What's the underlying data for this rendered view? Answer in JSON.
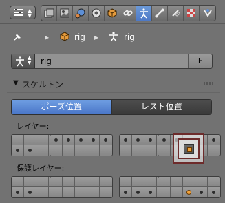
{
  "header": {
    "editor_type_icon": "properties-editor-icon",
    "context_tabs": [
      {
        "name": "render-layers-icon",
        "active": false
      },
      {
        "name": "scene-icon",
        "active": false
      },
      {
        "name": "world-icon",
        "active": false
      },
      {
        "name": "object-icon",
        "active": false
      },
      {
        "name": "cube-icon",
        "active": false
      },
      {
        "name": "constraints-link-icon",
        "active": false
      },
      {
        "name": "armature-data-icon",
        "active": true
      },
      {
        "name": "bone-icon",
        "active": false
      },
      {
        "name": "bone-constraints-icon",
        "active": false
      },
      {
        "name": "texture-icon",
        "active": false
      },
      {
        "name": "physics-icon",
        "active": false
      }
    ]
  },
  "breadcrumb": {
    "object_name": "rig",
    "data_name": "rig"
  },
  "datablock": {
    "name": "rig",
    "fake_user_label": "F"
  },
  "panel": {
    "title": "スケルトン",
    "pose_position_label": "ポーズ位置",
    "rest_position_label": "レスト位置",
    "layers_label": "レイヤー:",
    "protected_layers_label": "保護レイヤー:"
  },
  "colors": {
    "active_blue": "#5a8ad6",
    "background": "#727272",
    "active_layer_dot": "#f2a23a",
    "highlight_border": "#6d2b2b"
  }
}
